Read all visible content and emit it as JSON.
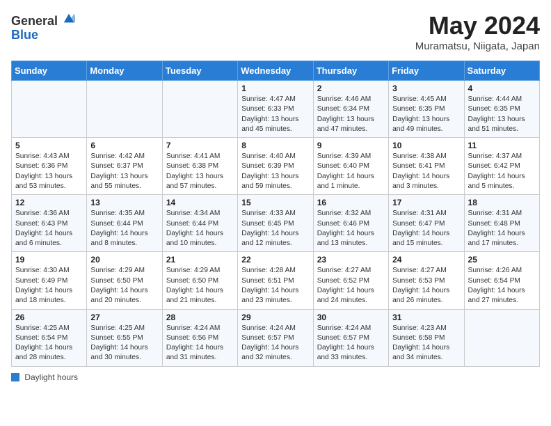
{
  "header": {
    "logo_general": "General",
    "logo_blue": "Blue",
    "month_title": "May 2024",
    "location": "Muramatsu, Niigata, Japan"
  },
  "days_of_week": [
    "Sunday",
    "Monday",
    "Tuesday",
    "Wednesday",
    "Thursday",
    "Friday",
    "Saturday"
  ],
  "weeks": [
    [
      {
        "day": "",
        "info": ""
      },
      {
        "day": "",
        "info": ""
      },
      {
        "day": "",
        "info": ""
      },
      {
        "day": "1",
        "info": "Sunrise: 4:47 AM\nSunset: 6:33 PM\nDaylight: 13 hours\nand 45 minutes."
      },
      {
        "day": "2",
        "info": "Sunrise: 4:46 AM\nSunset: 6:34 PM\nDaylight: 13 hours\nand 47 minutes."
      },
      {
        "day": "3",
        "info": "Sunrise: 4:45 AM\nSunset: 6:35 PM\nDaylight: 13 hours\nand 49 minutes."
      },
      {
        "day": "4",
        "info": "Sunrise: 4:44 AM\nSunset: 6:35 PM\nDaylight: 13 hours\nand 51 minutes."
      }
    ],
    [
      {
        "day": "5",
        "info": "Sunrise: 4:43 AM\nSunset: 6:36 PM\nDaylight: 13 hours\nand 53 minutes."
      },
      {
        "day": "6",
        "info": "Sunrise: 4:42 AM\nSunset: 6:37 PM\nDaylight: 13 hours\nand 55 minutes."
      },
      {
        "day": "7",
        "info": "Sunrise: 4:41 AM\nSunset: 6:38 PM\nDaylight: 13 hours\nand 57 minutes."
      },
      {
        "day": "8",
        "info": "Sunrise: 4:40 AM\nSunset: 6:39 PM\nDaylight: 13 hours\nand 59 minutes."
      },
      {
        "day": "9",
        "info": "Sunrise: 4:39 AM\nSunset: 6:40 PM\nDaylight: 14 hours\nand 1 minute."
      },
      {
        "day": "10",
        "info": "Sunrise: 4:38 AM\nSunset: 6:41 PM\nDaylight: 14 hours\nand 3 minutes."
      },
      {
        "day": "11",
        "info": "Sunrise: 4:37 AM\nSunset: 6:42 PM\nDaylight: 14 hours\nand 5 minutes."
      }
    ],
    [
      {
        "day": "12",
        "info": "Sunrise: 4:36 AM\nSunset: 6:43 PM\nDaylight: 14 hours\nand 6 minutes."
      },
      {
        "day": "13",
        "info": "Sunrise: 4:35 AM\nSunset: 6:44 PM\nDaylight: 14 hours\nand 8 minutes."
      },
      {
        "day": "14",
        "info": "Sunrise: 4:34 AM\nSunset: 6:44 PM\nDaylight: 14 hours\nand 10 minutes."
      },
      {
        "day": "15",
        "info": "Sunrise: 4:33 AM\nSunset: 6:45 PM\nDaylight: 14 hours\nand 12 minutes."
      },
      {
        "day": "16",
        "info": "Sunrise: 4:32 AM\nSunset: 6:46 PM\nDaylight: 14 hours\nand 13 minutes."
      },
      {
        "day": "17",
        "info": "Sunrise: 4:31 AM\nSunset: 6:47 PM\nDaylight: 14 hours\nand 15 minutes."
      },
      {
        "day": "18",
        "info": "Sunrise: 4:31 AM\nSunset: 6:48 PM\nDaylight: 14 hours\nand 17 minutes."
      }
    ],
    [
      {
        "day": "19",
        "info": "Sunrise: 4:30 AM\nSunset: 6:49 PM\nDaylight: 14 hours\nand 18 minutes."
      },
      {
        "day": "20",
        "info": "Sunrise: 4:29 AM\nSunset: 6:50 PM\nDaylight: 14 hours\nand 20 minutes."
      },
      {
        "day": "21",
        "info": "Sunrise: 4:29 AM\nSunset: 6:50 PM\nDaylight: 14 hours\nand 21 minutes."
      },
      {
        "day": "22",
        "info": "Sunrise: 4:28 AM\nSunset: 6:51 PM\nDaylight: 14 hours\nand 23 minutes."
      },
      {
        "day": "23",
        "info": "Sunrise: 4:27 AM\nSunset: 6:52 PM\nDaylight: 14 hours\nand 24 minutes."
      },
      {
        "day": "24",
        "info": "Sunrise: 4:27 AM\nSunset: 6:53 PM\nDaylight: 14 hours\nand 26 minutes."
      },
      {
        "day": "25",
        "info": "Sunrise: 4:26 AM\nSunset: 6:54 PM\nDaylight: 14 hours\nand 27 minutes."
      }
    ],
    [
      {
        "day": "26",
        "info": "Sunrise: 4:25 AM\nSunset: 6:54 PM\nDaylight: 14 hours\nand 28 minutes."
      },
      {
        "day": "27",
        "info": "Sunrise: 4:25 AM\nSunset: 6:55 PM\nDaylight: 14 hours\nand 30 minutes."
      },
      {
        "day": "28",
        "info": "Sunrise: 4:24 AM\nSunset: 6:56 PM\nDaylight: 14 hours\nand 31 minutes."
      },
      {
        "day": "29",
        "info": "Sunrise: 4:24 AM\nSunset: 6:57 PM\nDaylight: 14 hours\nand 32 minutes."
      },
      {
        "day": "30",
        "info": "Sunrise: 4:24 AM\nSunset: 6:57 PM\nDaylight: 14 hours\nand 33 minutes."
      },
      {
        "day": "31",
        "info": "Sunrise: 4:23 AM\nSunset: 6:58 PM\nDaylight: 14 hours\nand 34 minutes."
      },
      {
        "day": "",
        "info": ""
      }
    ]
  ],
  "footer": {
    "label": "Daylight hours"
  }
}
